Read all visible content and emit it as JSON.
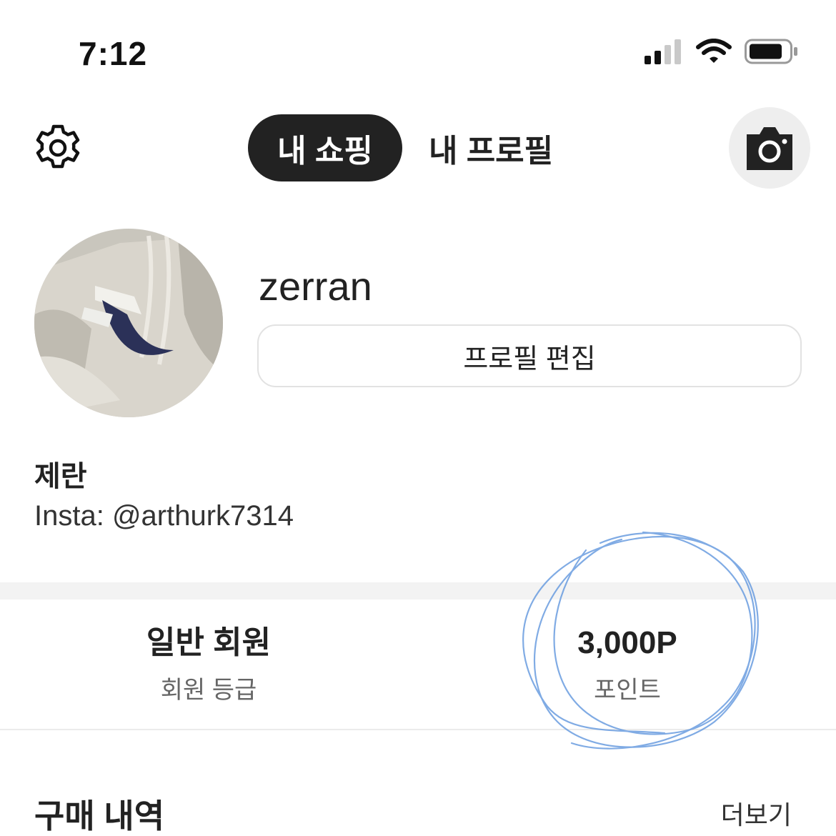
{
  "status_bar": {
    "time": "7:12"
  },
  "header": {
    "tabs": [
      {
        "label": "내 쇼핑",
        "active": true
      },
      {
        "label": "내 프로필",
        "active": false
      }
    ],
    "left_icon": "gear-icon",
    "right_icon": "camera-icon"
  },
  "profile": {
    "username": "zerran",
    "edit_button_label": "프로필 편집",
    "display_name": "제란",
    "bio": "Insta: @arthurk7314",
    "avatar_image": "hoodie-photo"
  },
  "stats": {
    "membership": {
      "value": "일반 회원",
      "label": "회원 등급"
    },
    "points": {
      "value": "3,000P",
      "label": "포인트"
    }
  },
  "purchase_history": {
    "title": "구매 내역",
    "more_label": "더보기"
  },
  "colors": {
    "active_tab_bg": "#222222",
    "camera_btn_bg": "#eeeeee",
    "divider": "#f3f3f3",
    "annotation_ink": "#6a9de0"
  }
}
